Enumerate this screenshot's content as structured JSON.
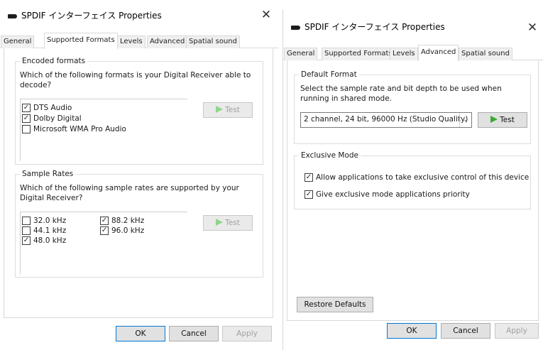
{
  "left": {
    "title": "SPDIF インターフェイス Properties",
    "close": "✕",
    "tabs": [
      "General",
      "Supported Formats",
      "Levels",
      "Advanced",
      "Spatial sound"
    ],
    "encoded": {
      "title": "Encoded formats",
      "description": "Which of the following formats is your Digital Receiver able to decode?",
      "items": [
        {
          "label": "DTS Audio",
          "checked": true
        },
        {
          "label": "Dolby Digital",
          "checked": true
        },
        {
          "label": "Microsoft WMA Pro Audio",
          "checked": false
        }
      ],
      "test_label": "Test"
    },
    "rates": {
      "title": "Sample Rates",
      "description": "Which of the following sample rates are supported by your Digital Receiver?",
      "items": [
        {
          "label": "32.0 kHz",
          "checked": false
        },
        {
          "label": "44.1 kHz",
          "checked": false
        },
        {
          "label": "48.0 kHz",
          "checked": true
        },
        {
          "label": "88.2 kHz",
          "checked": true
        },
        {
          "label": "96.0 kHz",
          "checked": true
        }
      ],
      "test_label": "Test"
    },
    "buttons": {
      "ok": "OK",
      "cancel": "Cancel",
      "apply": "Apply"
    }
  },
  "right": {
    "title": "SPDIF インターフェイス Properties",
    "close": "✕",
    "tabs": [
      "General",
      "Supported Formats",
      "Levels",
      "Advanced",
      "Spatial sound"
    ],
    "default_format": {
      "title": "Default Format",
      "description": "Select the sample rate and bit depth to be used when running in shared mode.",
      "selected": "2 channel, 24 bit, 96000 Hz (Studio Quality)",
      "test_label": "Test"
    },
    "exclusive": {
      "title": "Exclusive Mode",
      "items": [
        {
          "label": "Allow applications to take exclusive control of this device",
          "checked": true
        },
        {
          "label": "Give exclusive mode applications priority",
          "checked": true
        }
      ]
    },
    "restore_label": "Restore Defaults",
    "buttons": {
      "ok": "OK",
      "cancel": "Cancel",
      "apply": "Apply"
    }
  },
  "colors": {
    "accent": "#0078d7",
    "play": "#3aaa35"
  },
  "icons": {
    "app": "speaker-icon",
    "close": "close-icon",
    "check": "checkmark-icon",
    "play": "play-icon",
    "dropdown": "chevron-down-icon"
  }
}
